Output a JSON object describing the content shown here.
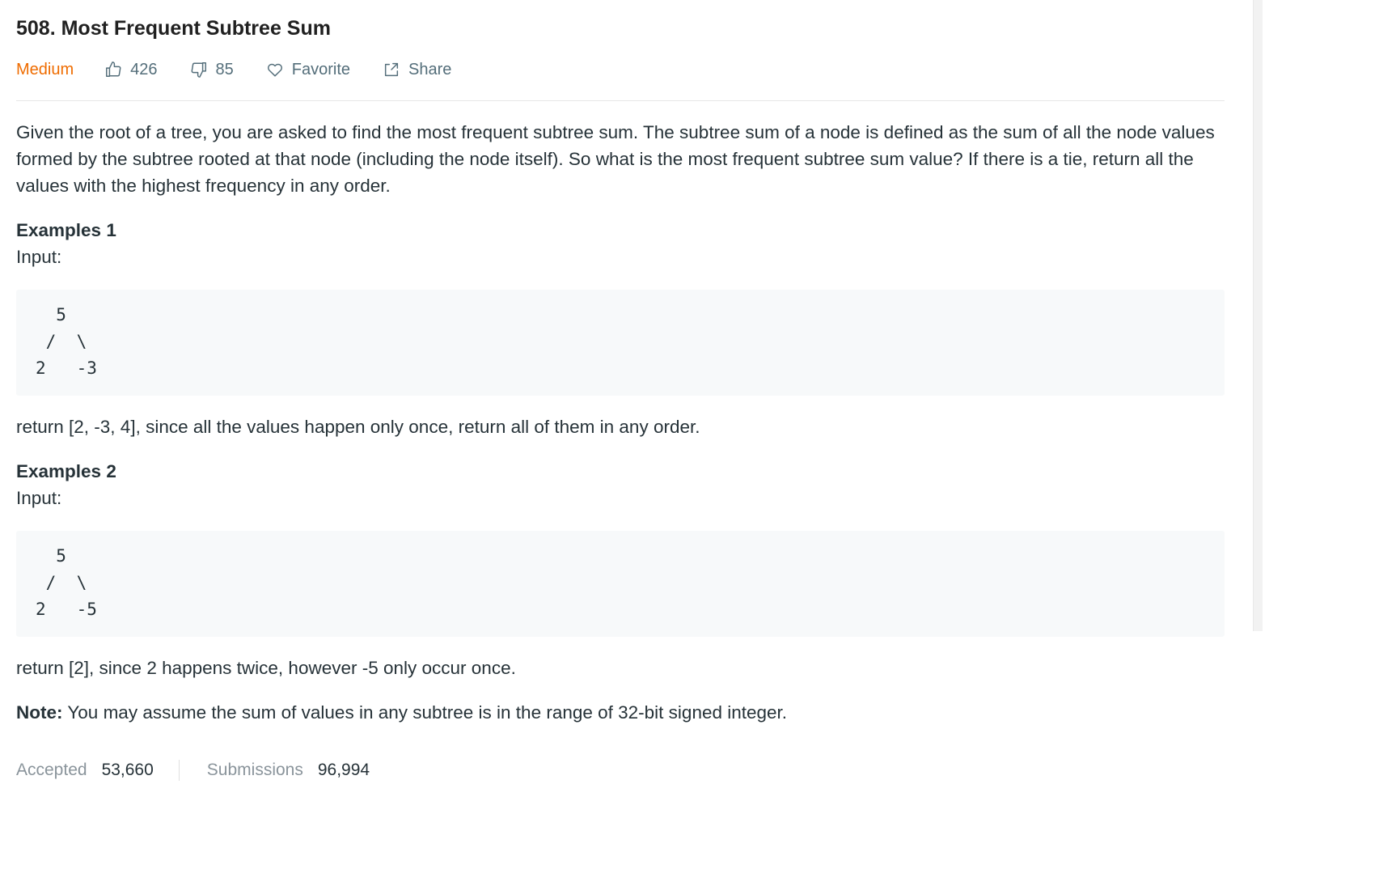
{
  "problem": {
    "title": "508. Most Frequent Subtree Sum",
    "difficulty": "Medium",
    "likes": "426",
    "dislikes": "85",
    "favorite_label": "Favorite",
    "share_label": "Share"
  },
  "description": "Given the root of a tree, you are asked to find the most frequent subtree sum. The subtree sum of a node is defined as the sum of all the node values formed by the subtree rooted at that node (including the node itself). So what is the most frequent subtree sum value? If there is a tie, return all the values with the highest frequency in any order.",
  "examples": [
    {
      "heading": "Examples 1",
      "input_label": "Input:",
      "tree": "  5\n /  \\\n2   -3",
      "result": "return [2, -3, 4], since all the values happen only once, return all of them in any order."
    },
    {
      "heading": "Examples 2",
      "input_label": "Input:",
      "tree": "  5\n /  \\\n2   -5",
      "result": "return [2], since 2 happens twice, however -5 only occur once."
    }
  ],
  "note": {
    "label": "Note:",
    "text": " You may assume the sum of values in any subtree is in the range of 32-bit signed integer."
  },
  "stats": {
    "accepted_label": "Accepted",
    "accepted_value": "53,660",
    "submissions_label": "Submissions",
    "submissions_value": "96,994"
  }
}
